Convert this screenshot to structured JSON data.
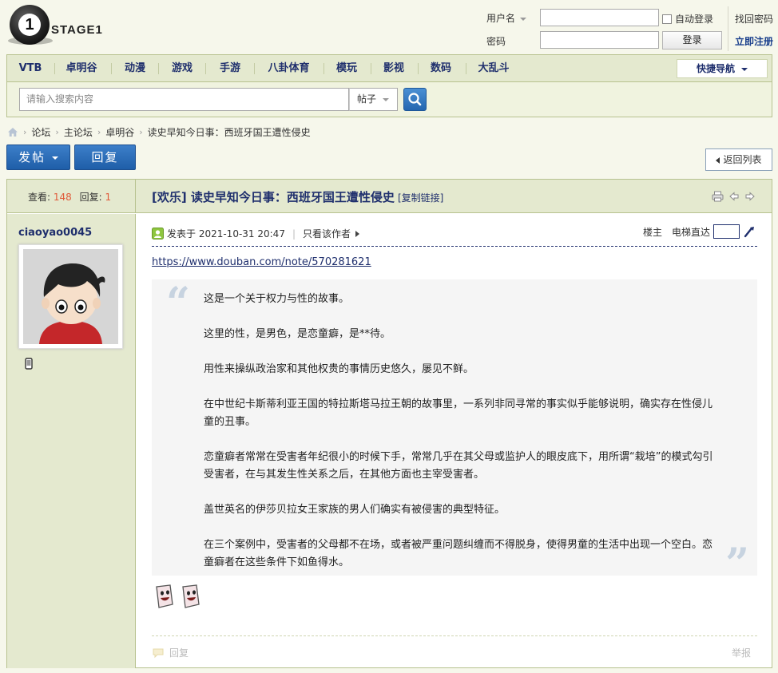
{
  "brand": {
    "logo_glyph": "1",
    "logo_text": "STAGE1"
  },
  "login": {
    "username_label": "用户名",
    "password_label": "密码",
    "auto_login_label": "自动登录",
    "login_button": "登录",
    "find_password": "找回密码",
    "register": "立即注册"
  },
  "nav": {
    "items": [
      "VTB",
      "卓明谷",
      "动漫",
      "游戏",
      "手游",
      "八卦体育",
      "模玩",
      "影视",
      "数码",
      "大乱斗"
    ],
    "quick_nav": "快捷导航"
  },
  "search": {
    "placeholder": "请输入搜索内容",
    "type": "帖子"
  },
  "breadcrumb": [
    "论坛",
    "主论坛",
    "卓明谷",
    "读史早知今日事：西班牙国王遭性侵史"
  ],
  "actions": {
    "post": "发帖",
    "reply": "回复",
    "back_to_list": "返回列表"
  },
  "thread": {
    "views_label": "查看:",
    "views": "148",
    "replies_label": "回复:",
    "replies": "1",
    "title": "[欢乐] 读史早知今日事：西班牙国王遭性侵史",
    "copy_link": "[复制链接]"
  },
  "post": {
    "author": "ciaoyao0045",
    "posted_at": "发表于 2021-10-31 20:47",
    "only_author": "只看该作者",
    "floor_label": "楼主",
    "jump_label": "电梯直达",
    "link": "https://www.douban.com/note/570281621",
    "paragraphs": [
      "这是一个关于权力与性的故事。",
      "这里的性，是男色，是恋童癖，是**待。",
      "用性来操纵政治家和其他权贵的事情历史悠久，屡见不鲜。",
      "在中世纪卡斯蒂利亚王国的特拉斯塔马拉王朝的故事里，一系列非同寻常的事实似乎能够说明，确实存在性侵儿童的丑事。",
      "恋童癖者常常在受害者年纪很小的时候下手，常常几乎在其父母或监护人的眼皮底下，用所谓“栽培”的模式勾引受害者，在与其发生性关系之后，在其他方面也主宰受害者。",
      "盖世英名的伊莎贝拉女王家族的男人们确实有被侵害的典型特征。",
      "在三个案例中，受害者的父母都不在场，或者被严重问题纠缠而不得脱身，使得男童的生活中出现一个空白。恋童癖者在这些条件下如鱼得水。"
    ],
    "reply_action": "回复",
    "report_action": "举报"
  },
  "colors": {
    "accent": "#1f2f6d",
    "nav_bg": "#e4e9cf",
    "border": "#b7c28f",
    "button_blue": "#2a6cb8",
    "stat_number": "#e05a3a"
  }
}
